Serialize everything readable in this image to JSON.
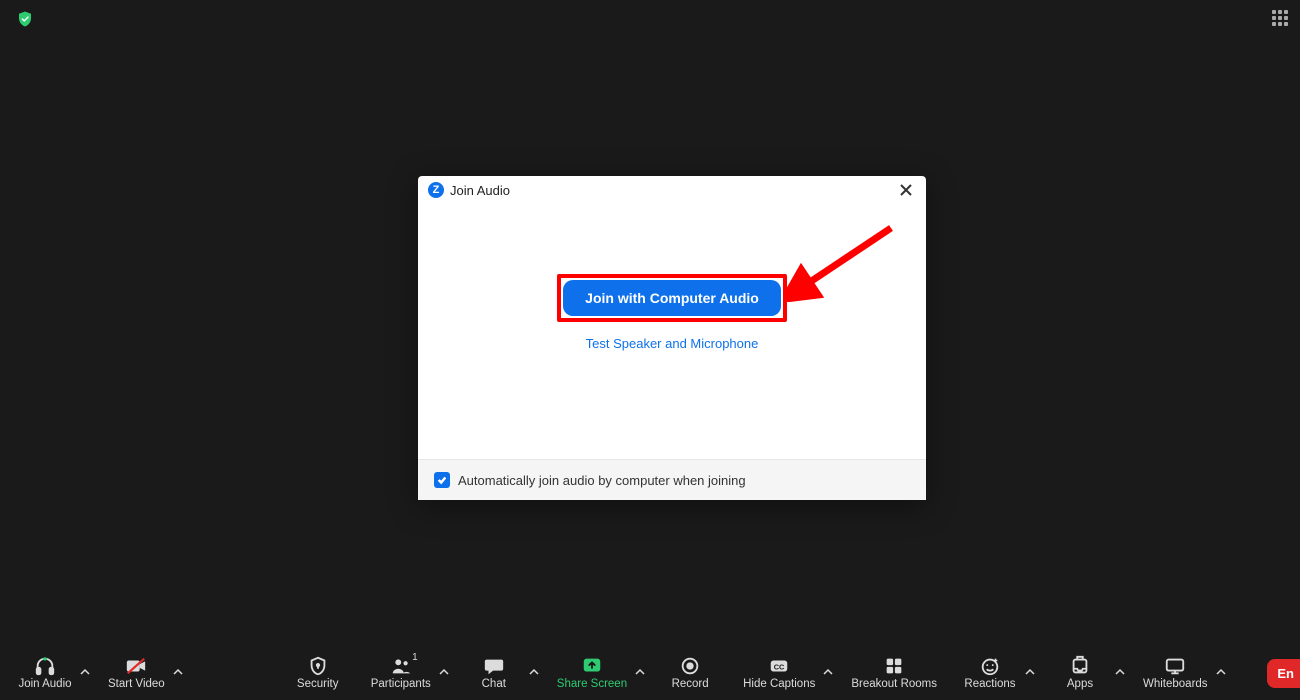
{
  "topbar": {
    "shield_color": "#2ecc71",
    "grid_color": "#aaaaaa"
  },
  "dialog": {
    "title": "Join Audio",
    "join_button": "Join with Computer Audio",
    "test_link": "Test Speaker and Microphone",
    "auto_join_label": "Automatically join audio by computer when joining",
    "auto_join_checked": true
  },
  "toolbar": {
    "items": [
      {
        "id": "join-audio",
        "label": "Join Audio",
        "caret": true
      },
      {
        "id": "start-video",
        "label": "Start Video",
        "caret": true
      },
      {
        "id": "security",
        "label": "Security",
        "caret": false
      },
      {
        "id": "participants",
        "label": "Participants",
        "caret": true,
        "badge": "1"
      },
      {
        "id": "chat",
        "label": "Chat",
        "caret": true
      },
      {
        "id": "share-screen",
        "label": "Share Screen",
        "caret": true,
        "color": "green"
      },
      {
        "id": "record",
        "label": "Record",
        "caret": false
      },
      {
        "id": "hide-captions",
        "label": "Hide Captions",
        "caret": true
      },
      {
        "id": "breakout-rooms",
        "label": "Breakout Rooms",
        "caret": false
      },
      {
        "id": "reactions",
        "label": "Reactions",
        "caret": true
      },
      {
        "id": "apps",
        "label": "Apps",
        "caret": true
      },
      {
        "id": "whiteboards",
        "label": "Whiteboards",
        "caret": true
      }
    ],
    "end_label": "En"
  },
  "annotation": {
    "highlight_color": "#ff0000"
  }
}
